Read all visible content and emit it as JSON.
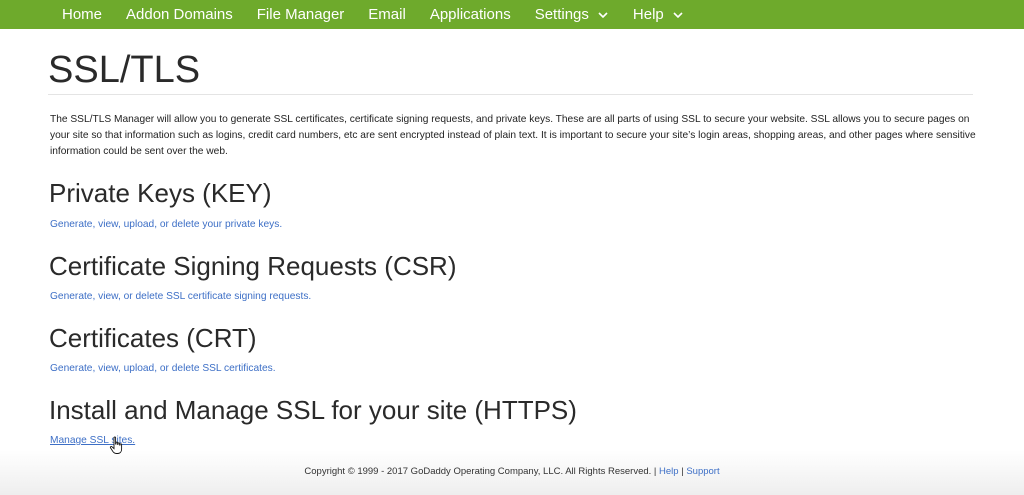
{
  "nav": {
    "items": [
      {
        "label": "Home",
        "dropdown": false
      },
      {
        "label": "Addon Domains",
        "dropdown": false
      },
      {
        "label": "File Manager",
        "dropdown": false
      },
      {
        "label": "Email",
        "dropdown": false
      },
      {
        "label": "Applications",
        "dropdown": false
      },
      {
        "label": "Settings",
        "dropdown": true
      },
      {
        "label": "Help",
        "dropdown": true
      }
    ],
    "bg_color": "#6eaa2c"
  },
  "page": {
    "title": "SSL/TLS",
    "intro": "The SSL/TLS Manager will allow you to generate SSL certificates, certificate signing requests, and private keys. These are all parts of using SSL to secure your website. SSL allows you to secure pages on your site so that information such as logins, credit card numbers, etc are sent encrypted instead of plain text. It is important to secure your site’s login areas, shopping areas, and other pages where sensitive information could be sent over the web."
  },
  "sections": [
    {
      "title": "Private Keys (KEY)",
      "link": "Generate, view, upload, or delete your private keys."
    },
    {
      "title": "Certificate Signing Requests (CSR)",
      "link": "Generate, view, or delete SSL certificate signing requests."
    },
    {
      "title": "Certificates (CRT)",
      "link": "Generate, view, upload, or delete SSL certificates."
    },
    {
      "title": "Install and Manage SSL for your site (HTTPS)",
      "link": "Manage SSL sites."
    }
  ],
  "footer": {
    "copyright": "Copyright © 1999 - 2017 GoDaddy Operating Company, LLC. All Rights Reserved. | ",
    "help_label": "Help",
    "separator": " | ",
    "support_label": "Support"
  },
  "colors": {
    "link": "#3d6fc6",
    "heading": "#2a2a2a"
  }
}
